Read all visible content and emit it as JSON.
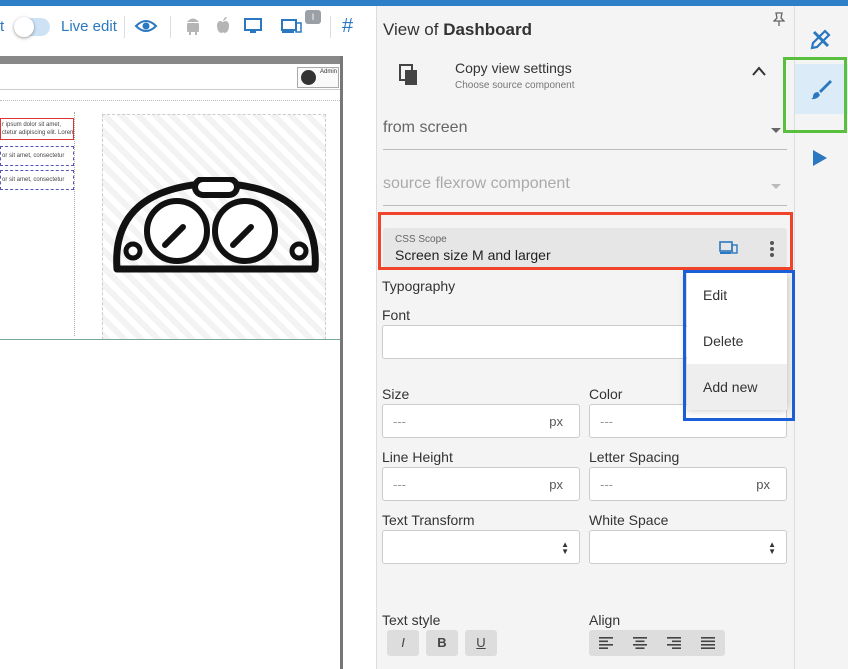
{
  "toolbar": {
    "edit_tail": "t",
    "live_edit": "Live edit",
    "badge": "I",
    "hash": "#"
  },
  "canvas": {
    "admin_label": "Admin",
    "text_lines": [
      "r ipsum dolor sit amet,",
      "ctetur adipiscing elit. Lorem",
      "or sit amet, consectetur",
      "or sit amet, consectetur"
    ]
  },
  "panel": {
    "title_prefix": "View of",
    "title_name": "Dashboard",
    "copy": {
      "title": "Copy view settings",
      "subtitle": "Choose source component"
    },
    "from_screen": "from screen",
    "source_component": "source flexrow component",
    "scope": {
      "label": "CSS Scope",
      "value": "Screen size M and larger"
    },
    "typography": "Typography",
    "font": "Font",
    "size": {
      "label": "Size",
      "placeholder": "---",
      "unit": "px"
    },
    "color": {
      "label": "Color",
      "placeholder": "---"
    },
    "line_height": {
      "label": "Line Height",
      "placeholder": "---",
      "unit": "px"
    },
    "letter_spacing": {
      "label": "Letter Spacing",
      "placeholder": "---",
      "unit": "px"
    },
    "text_transform": "Text Transform",
    "white_space": "White Space",
    "text_style": "Text style",
    "align": "Align",
    "style_buttons": [
      "I",
      "B",
      "U"
    ]
  },
  "menu": {
    "items": [
      "Edit",
      "Delete",
      "Add new"
    ]
  },
  "colors": {
    "accent": "#2a78c0",
    "highlight_red": "#f0432a",
    "highlight_blue": "#1a5fd8",
    "highlight_green": "#58c03c"
  }
}
